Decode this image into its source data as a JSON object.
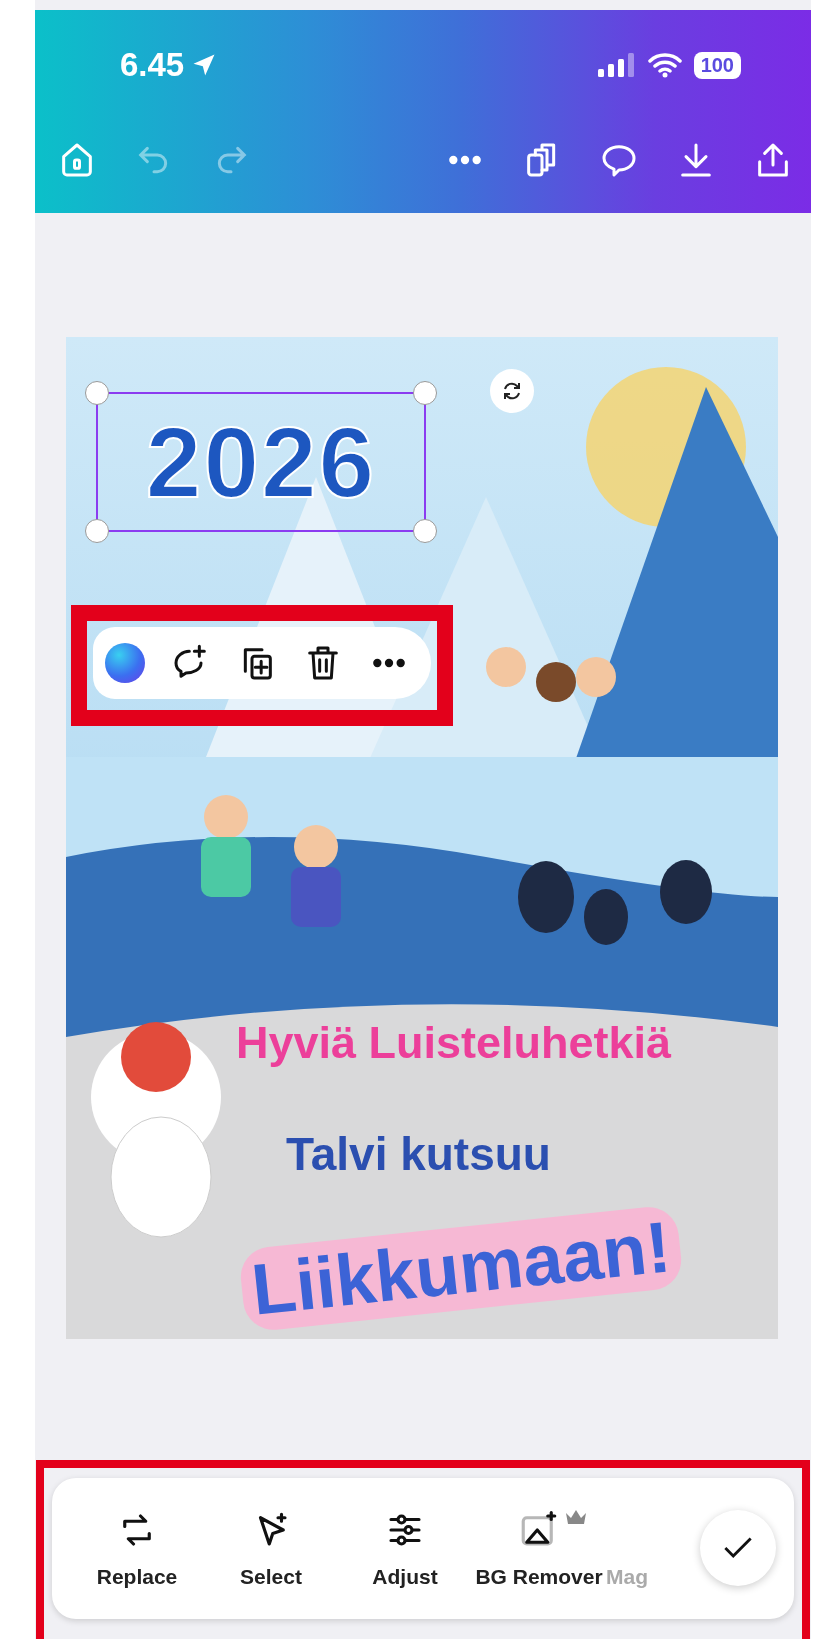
{
  "status_bar": {
    "time": "6.45",
    "battery": "100"
  },
  "top_toolbar": {
    "undo": {
      "disabled": true
    },
    "redo": {
      "disabled": true
    }
  },
  "canvas": {
    "texts": [
      {
        "kind": "year",
        "text": "2026",
        "selected": true
      },
      {
        "kind": "title",
        "text": "Hyviä Luisteluhetkiä",
        "selected": false
      },
      {
        "kind": "subtitle",
        "text": "Talvi kutsuu",
        "selected": false
      },
      {
        "kind": "headline",
        "text": "Liikkumaan!",
        "selected": false
      }
    ]
  },
  "bottom_toolbar": {
    "tools": [
      {
        "label": "Replace",
        "premium": false,
        "faded": false
      },
      {
        "label": "Select",
        "premium": false,
        "faded": false
      },
      {
        "label": "Adjust",
        "premium": false,
        "faded": false
      },
      {
        "label": "BG Remover",
        "premium": true,
        "faded": false
      },
      {
        "label": "Mag",
        "premium": false,
        "faded": true
      }
    ]
  }
}
